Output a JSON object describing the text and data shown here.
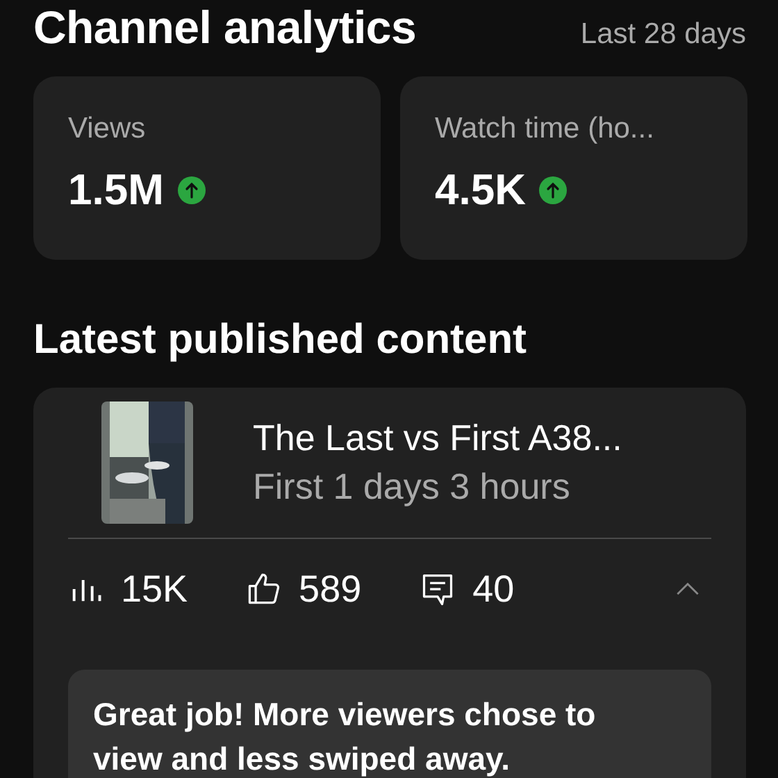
{
  "header": {
    "title": "Channel analytics",
    "period": "Last 28 days"
  },
  "metrics": [
    {
      "label": "Views",
      "value": "1.5M",
      "rising": true
    },
    {
      "label": "Watch time (ho...",
      "value": "4.5K",
      "rising": true
    }
  ],
  "latest": {
    "heading": "Latest published content",
    "video": {
      "title": "The Last vs First A38...",
      "subtitle": "First 1 days 3 hours"
    },
    "stats": [
      {
        "kind": "views",
        "value": "15K"
      },
      {
        "kind": "likes",
        "value": "589"
      },
      {
        "kind": "comments",
        "value": "40"
      }
    ],
    "expanded": true,
    "feedback": "Great job! More viewers chose to view and less swiped away."
  }
}
